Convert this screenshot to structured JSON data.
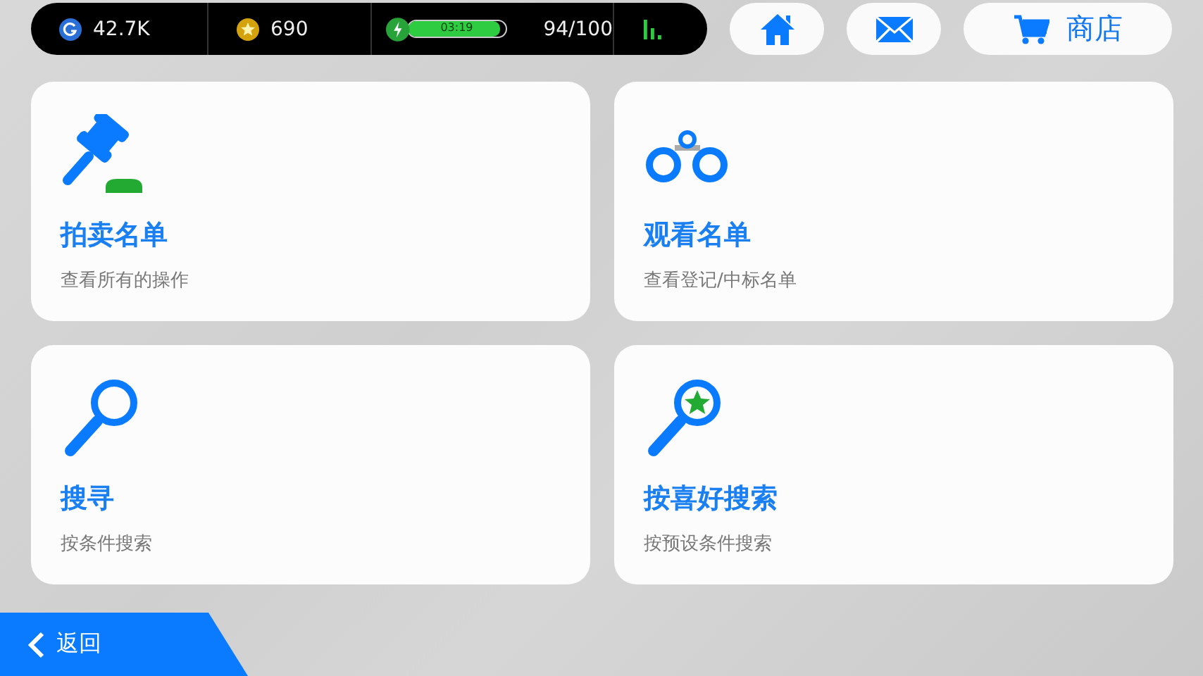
{
  "status_bar": {
    "coins": "42.7K",
    "stars": "690",
    "energy": {
      "timer": "03:19",
      "level": 0.94,
      "reading": "94/100"
    }
  },
  "nav_buttons": [
    {
      "kind": "home"
    },
    {
      "kind": "mail"
    },
    {
      "kind": "shop",
      "label": "商店"
    }
  ],
  "cards": [
    {
      "kind": "gavel",
      "title": "拍卖名单",
      "subtitle": "查看所有的操作"
    },
    {
      "kind": "handcuffs",
      "title": "观看名单",
      "subtitle": "查看登记/中标名单"
    },
    {
      "kind": "search",
      "title": "搜寻",
      "subtitle": "按条件搜索"
    },
    {
      "kind": "search-star",
      "title": "按喜好搜索",
      "subtitle": "按预设条件搜索"
    }
  ],
  "back_button": {
    "label": "返回"
  }
}
